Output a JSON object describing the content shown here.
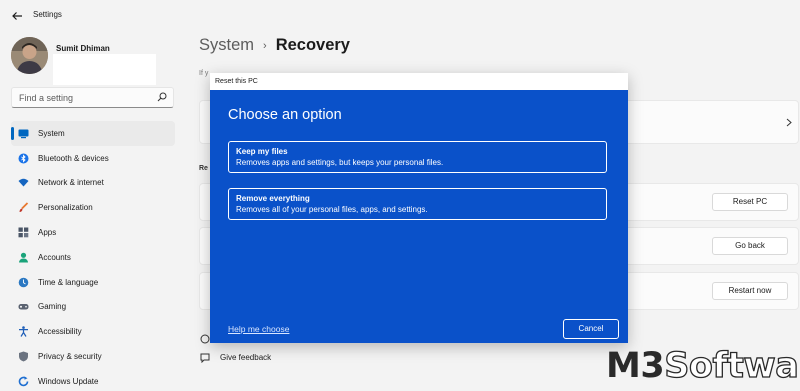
{
  "window": {
    "title": "Settings"
  },
  "profile": {
    "name": "Sumit Dhiman"
  },
  "search": {
    "placeholder": "Find a setting"
  },
  "sidebar": {
    "items": [
      {
        "label": "System",
        "icon": "monitor-icon",
        "active": true
      },
      {
        "label": "Bluetooth & devices",
        "icon": "bluetooth-icon"
      },
      {
        "label": "Network & internet",
        "icon": "wifi-icon"
      },
      {
        "label": "Personalization",
        "icon": "brush-icon"
      },
      {
        "label": "Apps",
        "icon": "apps-icon"
      },
      {
        "label": "Accounts",
        "icon": "person-icon"
      },
      {
        "label": "Time & language",
        "icon": "clock-icon"
      },
      {
        "label": "Gaming",
        "icon": "gamepad-icon"
      },
      {
        "label": "Accessibility",
        "icon": "accessibility-icon"
      },
      {
        "label": "Privacy & security",
        "icon": "shield-icon"
      },
      {
        "label": "Windows Update",
        "icon": "update-icon"
      }
    ]
  },
  "breadcrumb": {
    "parent": "System",
    "separator": "›",
    "current": "Recovery"
  },
  "recovery": {
    "intro_fragment": "If y",
    "section_fragment": "Re",
    "reset_button": "Reset PC",
    "goback_button": "Go back",
    "restart_button": "Restart now"
  },
  "footer": {
    "give_feedback": "Give feedback"
  },
  "dialog": {
    "title": "Reset this PC",
    "heading": "Choose an option",
    "options": [
      {
        "title": "Keep my files",
        "description": "Removes apps and settings, but keeps your personal files."
      },
      {
        "title": "Remove everything",
        "description": "Removes all of your personal files, apps, and settings."
      }
    ],
    "help_link": "Help me choose",
    "cancel_button": "Cancel"
  },
  "watermark": {
    "part1": "M3",
    "part2": "Software"
  },
  "colors": {
    "accent": "#0067c0",
    "dialog_bg": "#0a51c9",
    "window_bg": "#f3f3f3"
  }
}
